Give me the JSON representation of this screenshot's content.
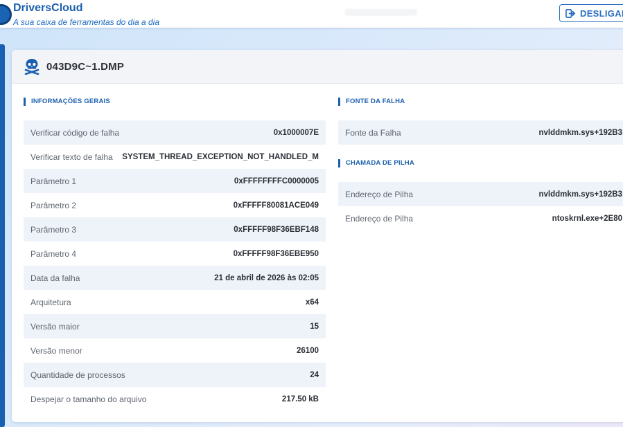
{
  "header": {
    "brand": "DriversCloud",
    "tagline": "A sua caixa de ferramentas do dia a dia",
    "logout_label": "DESLIGAR"
  },
  "card": {
    "title": "043D9C~1.DMP",
    "icon": "skull-crossbones-icon"
  },
  "general": {
    "title": "INFORMAÇÕES GERAIS",
    "rows": [
      {
        "label": "Verificar código de falha",
        "value": "0x1000007E"
      },
      {
        "label": "Verificar texto de falha",
        "value": "SYSTEM_THREAD_EXCEPTION_NOT_HANDLED_M"
      },
      {
        "label": "Parâmetro 1",
        "value": "0xFFFFFFFFC0000005"
      },
      {
        "label": "Parâmetro 2",
        "value": "0xFFFFF80081ACE049"
      },
      {
        "label": "Parâmetro 3",
        "value": "0xFFFFF98F36EBF148"
      },
      {
        "label": "Parâmetro 4",
        "value": "0xFFFFF98F36EBE950"
      },
      {
        "label": "Data da falha",
        "value": "21 de abril de 2026 às 02:05"
      },
      {
        "label": "Arquitetura",
        "value": "x64"
      },
      {
        "label": "Versão maior",
        "value": "15"
      },
      {
        "label": "Versão menor",
        "value": "26100"
      },
      {
        "label": "Quantidade de processos",
        "value": "24"
      },
      {
        "label": "Despejar o tamanho do arquivo",
        "value": "217.50 kB"
      }
    ]
  },
  "fault_source": {
    "title": "FONTE DA FALHA",
    "rows": [
      {
        "label": "Fonte da Falha",
        "value": "nvlddmkm.sys+192B3"
      }
    ]
  },
  "call_stack": {
    "title": "CHAMADA DE PILHA",
    "rows": [
      {
        "label": "Endereço de Pilha",
        "value": "nvlddmkm.sys+192B3"
      },
      {
        "label": "Endereço de Pilha",
        "value": "ntoskrnl.exe+2E80"
      }
    ]
  },
  "colors": {
    "accent": "#1c5fae",
    "row_alt": "#eef2f9"
  }
}
